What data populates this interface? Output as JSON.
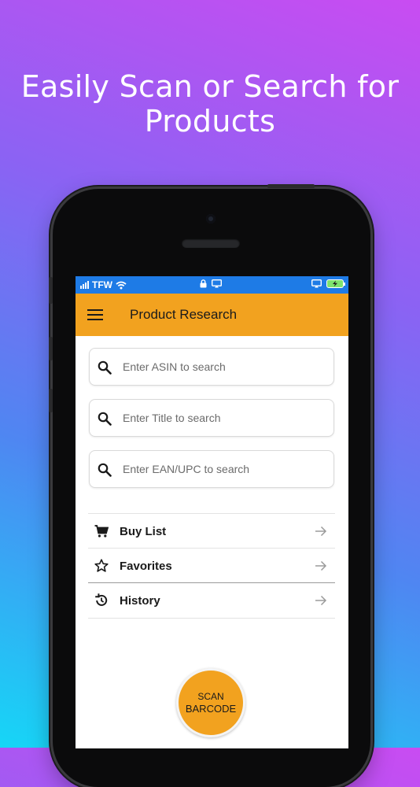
{
  "headline": {
    "line1": "Easily Scan or Search for",
    "line2": "Products"
  },
  "status_bar": {
    "carrier": "TFW"
  },
  "app_bar": {
    "title": "Product Research"
  },
  "search_fields": [
    {
      "placeholder": "Enter ASIN to search",
      "icon": "search-icon"
    },
    {
      "placeholder": "Enter Title to search",
      "icon": "search-icon"
    },
    {
      "placeholder": "Enter EAN/UPC to search",
      "icon": "search-icon"
    }
  ],
  "menu_items": [
    {
      "label": "Buy List",
      "icon": "cart-icon"
    },
    {
      "label": "Favorites",
      "icon": "star-icon"
    },
    {
      "label": "History",
      "icon": "history-icon"
    }
  ],
  "scan_button": {
    "line1": "SCAN",
    "line2": "BARCODE"
  },
  "colors": {
    "accent": "#f2a21f",
    "status_bar": "#1e7be6",
    "background_top": "#c94cf2",
    "background_bottom": "#16d6f6"
  }
}
